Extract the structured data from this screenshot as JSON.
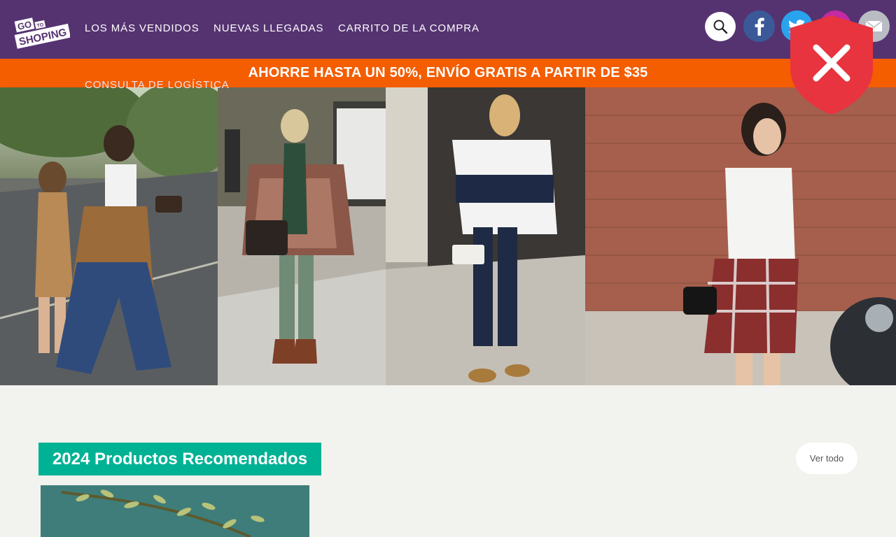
{
  "header": {
    "logo_text": {
      "line1": "GO",
      "line2": "TO",
      "line3": "SHOPING"
    },
    "nav": [
      {
        "label": "LOS MÁS VENDIDOS"
      },
      {
        "label": "NUEVAS LLEGADAS"
      },
      {
        "label": "CARRITO DE LA COMPRA"
      },
      {
        "label": "CONSULTA DE LOGÍSTICA"
      }
    ],
    "icons": [
      "search-icon",
      "facebook-icon",
      "twitter-icon",
      "instagram-icon",
      "email-icon"
    ]
  },
  "promo": {
    "text": "AHORRE HASTA UN 50%, ENVÍO GRATIS A PARTIR DE $35"
  },
  "security_badge": {
    "icon": "shield-close-icon",
    "color": "#e8343f"
  },
  "section": {
    "title": "2024 Productos Recomendados",
    "view_all_label": "Ver todo"
  },
  "colors": {
    "header_bg": "#553371",
    "promo_bg": "#f45d00",
    "section_title_bg": "#00b294",
    "page_bg": "#f2f2ee"
  }
}
